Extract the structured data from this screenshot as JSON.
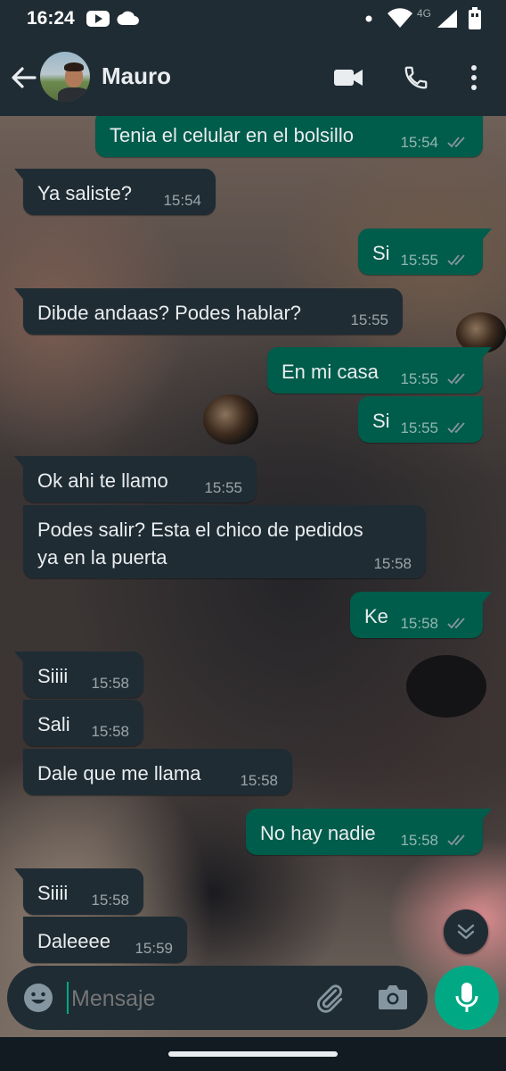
{
  "status_bar": {
    "time": "16:24",
    "network": "4G"
  },
  "header": {
    "contact_name": "Mauro"
  },
  "messages": [
    {
      "dir": "out",
      "text": "Tenia el celular en el bolsillo",
      "time": "15:54",
      "read": true
    },
    {
      "dir": "in",
      "text": "Ya saliste?",
      "time": "15:54"
    },
    {
      "dir": "out",
      "text": "Si",
      "time": "15:55",
      "read": true
    },
    {
      "dir": "in",
      "text": "Dibde andaas? Podes hablar?",
      "time": "15:55"
    },
    {
      "dir": "out",
      "text": "En mi casa",
      "time": "15:55",
      "read": true
    },
    {
      "dir": "out",
      "text": "Si",
      "time": "15:55",
      "read": true
    },
    {
      "dir": "in",
      "text": "Ok ahi te llamo",
      "time": "15:55"
    },
    {
      "dir": "in",
      "text": "Podes salir? Esta el chico de pedidos\nya en la puerta",
      "time": "15:58"
    },
    {
      "dir": "out",
      "text": "Ke",
      "time": "15:58",
      "read": true
    },
    {
      "dir": "in",
      "text": "Siiii",
      "time": "15:58"
    },
    {
      "dir": "in",
      "text": "Sali",
      "time": "15:58"
    },
    {
      "dir": "in",
      "text": "Dale que me llama",
      "time": "15:58"
    },
    {
      "dir": "out",
      "text": "No hay nadie",
      "time": "15:58",
      "read": true
    },
    {
      "dir": "in",
      "text": "Siiii",
      "time": "15:58"
    },
    {
      "dir": "in",
      "text": "Daleeee",
      "time": "15:59"
    }
  ],
  "composer": {
    "placeholder": "Mensaje"
  },
  "colors": {
    "header_bg": "#1f2c34",
    "incoming_bubble": "#1f2c34",
    "outgoing_bubble": "#005c4b",
    "accent": "#00a884",
    "read_ticks": "#8696a0"
  },
  "icons": [
    "back-arrow-icon",
    "video-call-icon",
    "phone-icon",
    "more-vert-icon",
    "emoji-icon",
    "attach-icon",
    "camera-icon",
    "mic-icon",
    "double-chevron-down-icon"
  ]
}
